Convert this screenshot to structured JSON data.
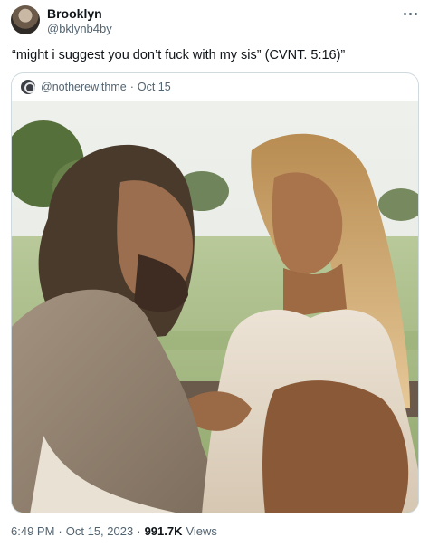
{
  "tweet": {
    "author_name": "Brooklyn",
    "author_handle": "@bklynb4by",
    "text": "“might i suggest you don’t fuck with my sis” (CVNT. 5:16)”",
    "time": "6:49 PM",
    "date": "Oct 15, 2023",
    "views_count": "991.7K",
    "views_label": "Views",
    "separator": "·"
  },
  "quote": {
    "handle": "@notherewithme",
    "date": "Oct 15",
    "separator": "·"
  },
  "icons": {
    "more": "more-horizontal-icon",
    "avatar": "profile-avatar",
    "quote_avatar": "profile-avatar"
  },
  "colors": {
    "text_primary": "#0f1419",
    "text_secondary": "#536471",
    "border": "#cfd9de"
  }
}
